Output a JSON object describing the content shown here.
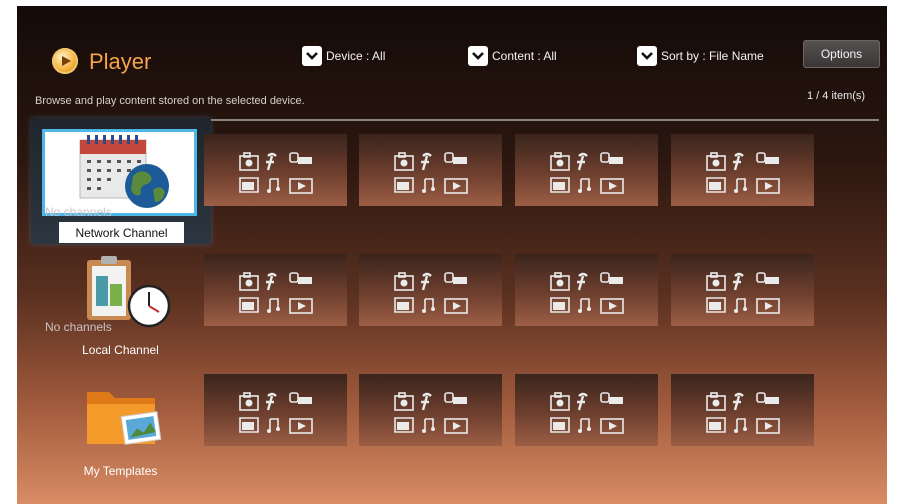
{
  "header": {
    "title": "Player",
    "logo_icon": "play-disc-icon",
    "filters": [
      {
        "label": "Device : All"
      },
      {
        "label": "Content : All"
      },
      {
        "label": "Sort by : File Name"
      }
    ],
    "options_label": "Options"
  },
  "subtitle": "Browse and play content stored on the selected device.",
  "item_count": "1 / 4 item(s)",
  "special_tiles": [
    {
      "label": "Network Channel",
      "status": "No channels",
      "icon": "calendar-globe-icon",
      "focused": true
    },
    {
      "label": "Local Channel",
      "status": "No channels",
      "icon": "clipboard-clock-icon",
      "focused": false
    },
    {
      "label": "My Templates",
      "status": "",
      "icon": "folder-image-icon",
      "focused": false
    }
  ],
  "placeholder_icons": [
    "camera-icon",
    "flash-icon",
    "video-icon",
    "image-icon",
    "music-icon",
    "play-icon"
  ],
  "colors": {
    "accent": "#f6a44a",
    "focus": "#4fb7e8"
  }
}
